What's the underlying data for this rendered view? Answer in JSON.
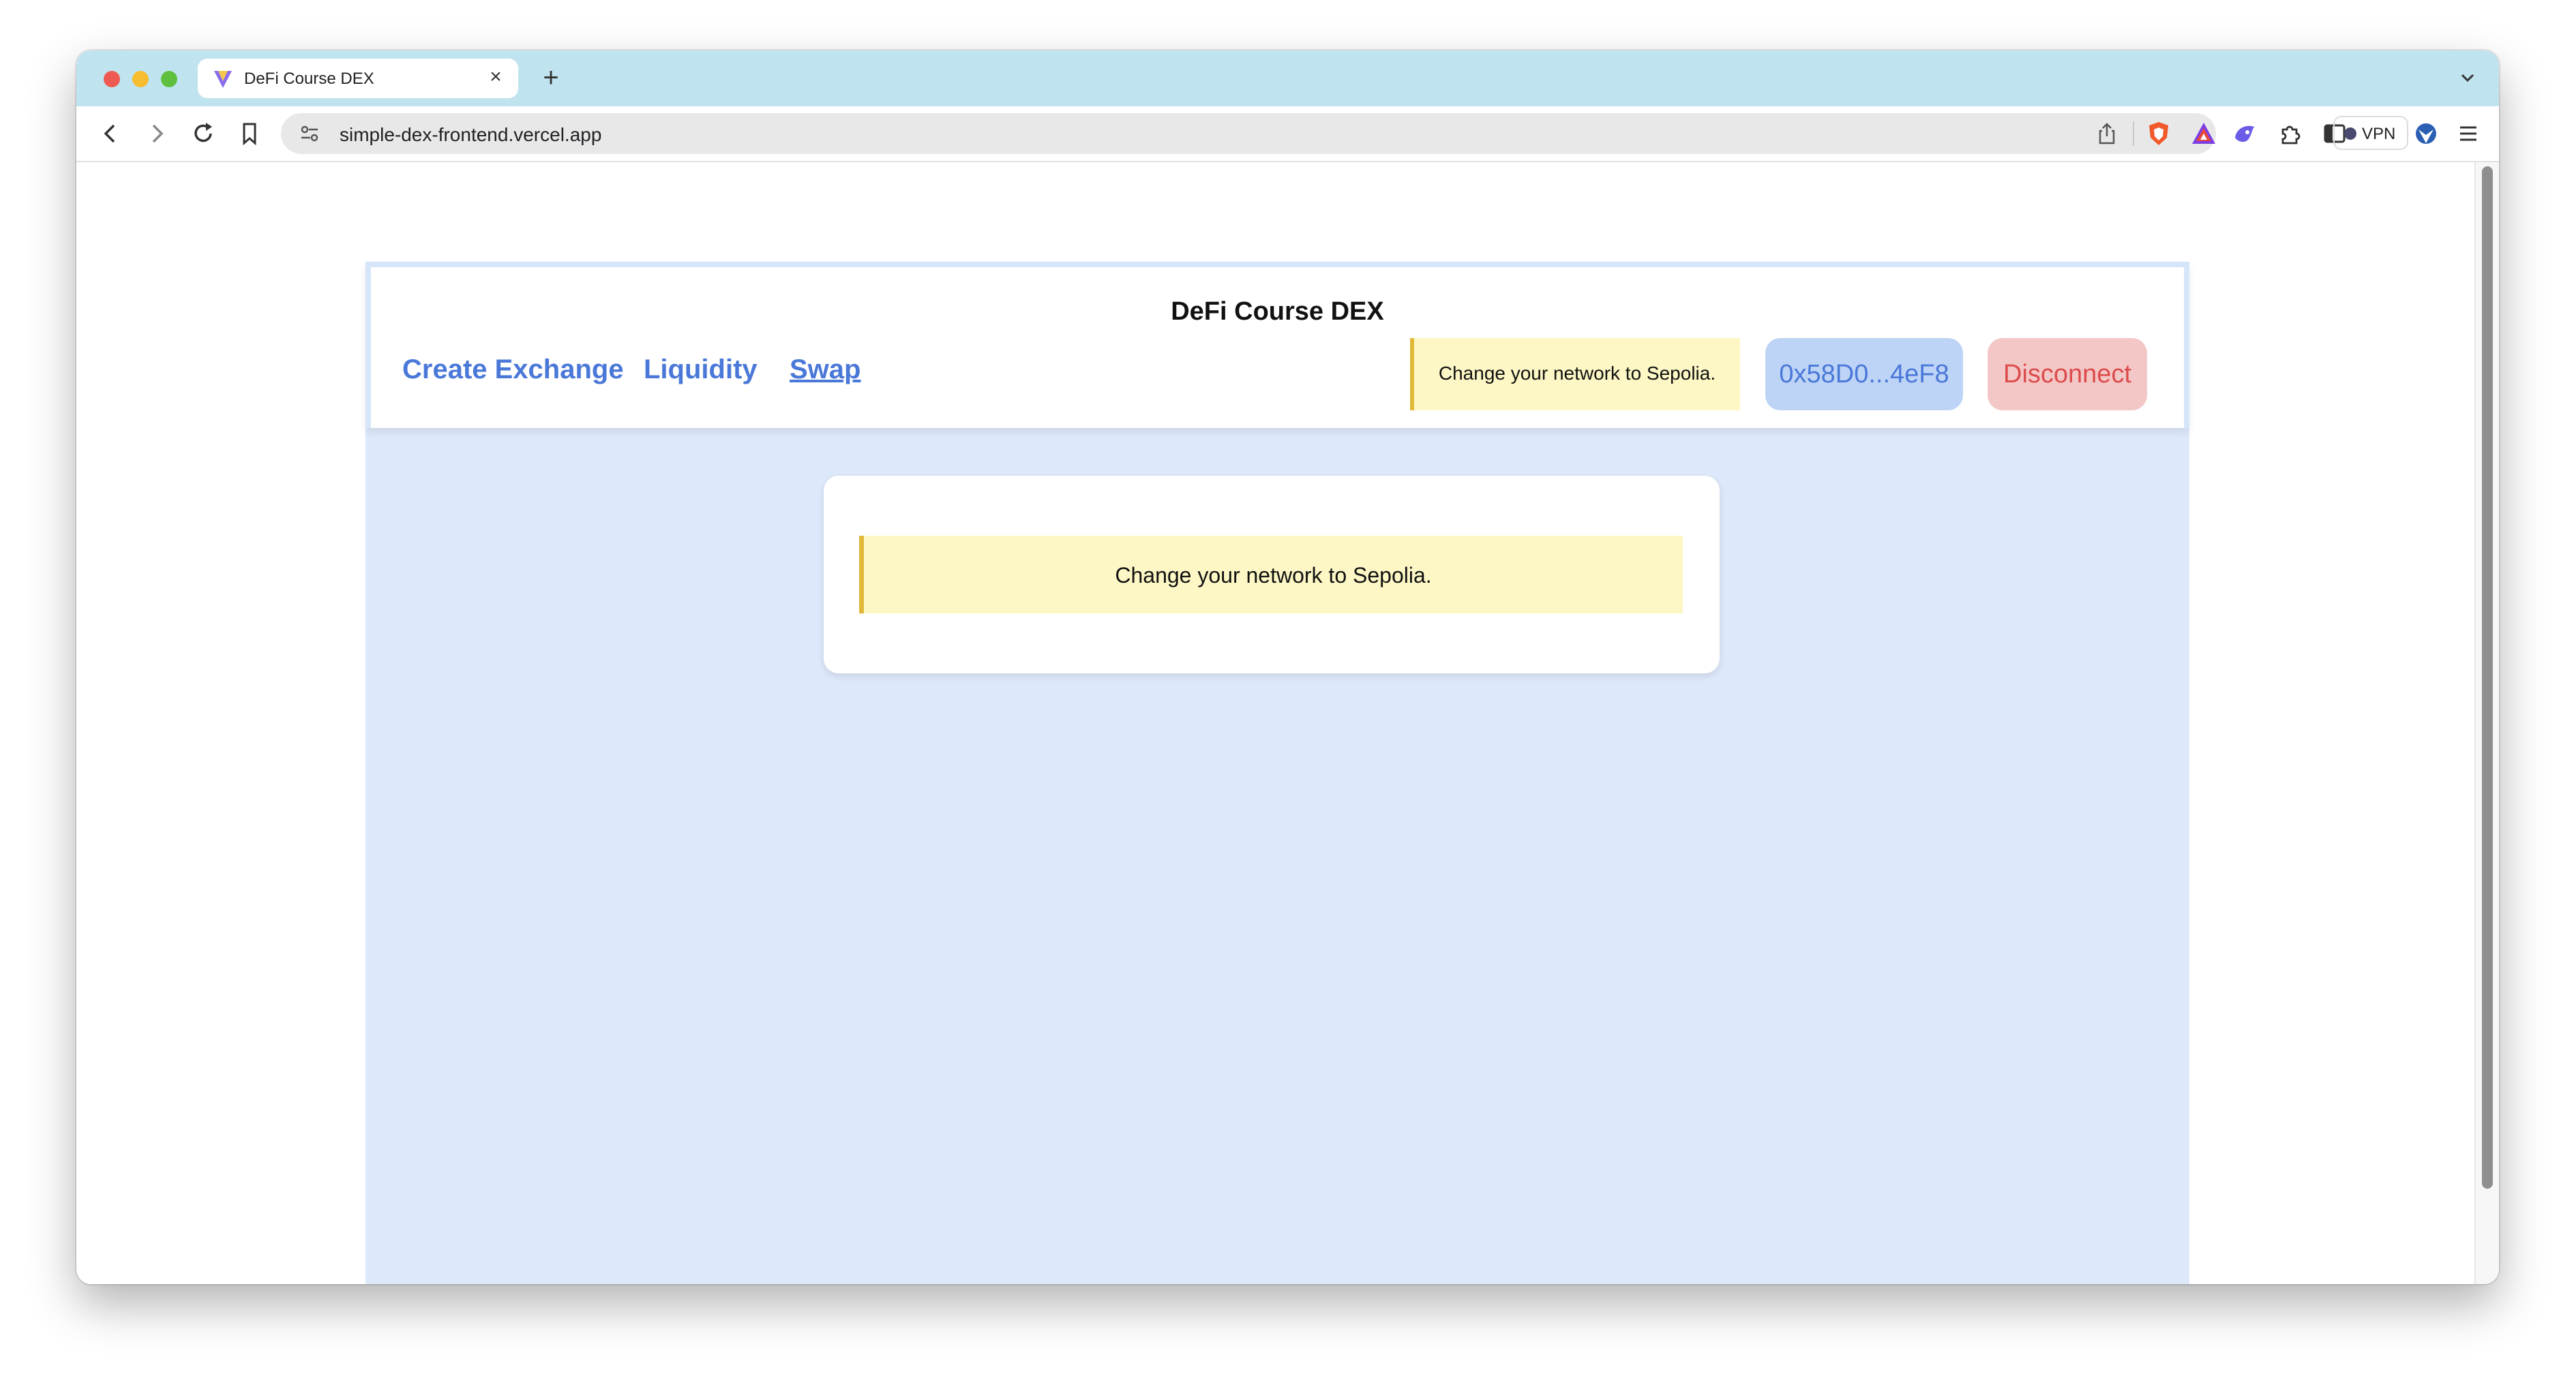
{
  "browser": {
    "tab_title": "DeFi Course DEX",
    "tab_close": "×",
    "new_tab": "+",
    "url": "simple-dex-frontend.vercel.app",
    "vpn_label": "VPN",
    "icons": [
      "back-icon",
      "forward-icon",
      "reload-icon",
      "bookmark-icon",
      "site-settings-icon",
      "share-icon",
      "brave-shield-icon",
      "brave-rewards-icon",
      "leo-ai-icon",
      "extensions-icon",
      "sidebar-icon",
      "wallet-icon",
      "vpn-icon",
      "profile-icon",
      "menu-icon"
    ]
  },
  "app": {
    "title": "DeFi Course DEX",
    "nav": {
      "create_exchange": "Create Exchange",
      "liquidity": "Liquidity",
      "swap": "Swap"
    },
    "header_alert": "Change your network to Sepolia.",
    "account_address": "0x58D0...4eF8",
    "disconnect_label": "Disconnect",
    "main_alert": "Change your network to Sepolia.",
    "colors": {
      "background": "#dde8fa",
      "link": "#4a78d8",
      "alert_bg": "#fcf7c4",
      "alert_border": "#e0b93a",
      "address_bg": "#bdd4f6",
      "disconnect_bg": "#f4c7c7",
      "disconnect_text": "#dc4b4b"
    }
  }
}
